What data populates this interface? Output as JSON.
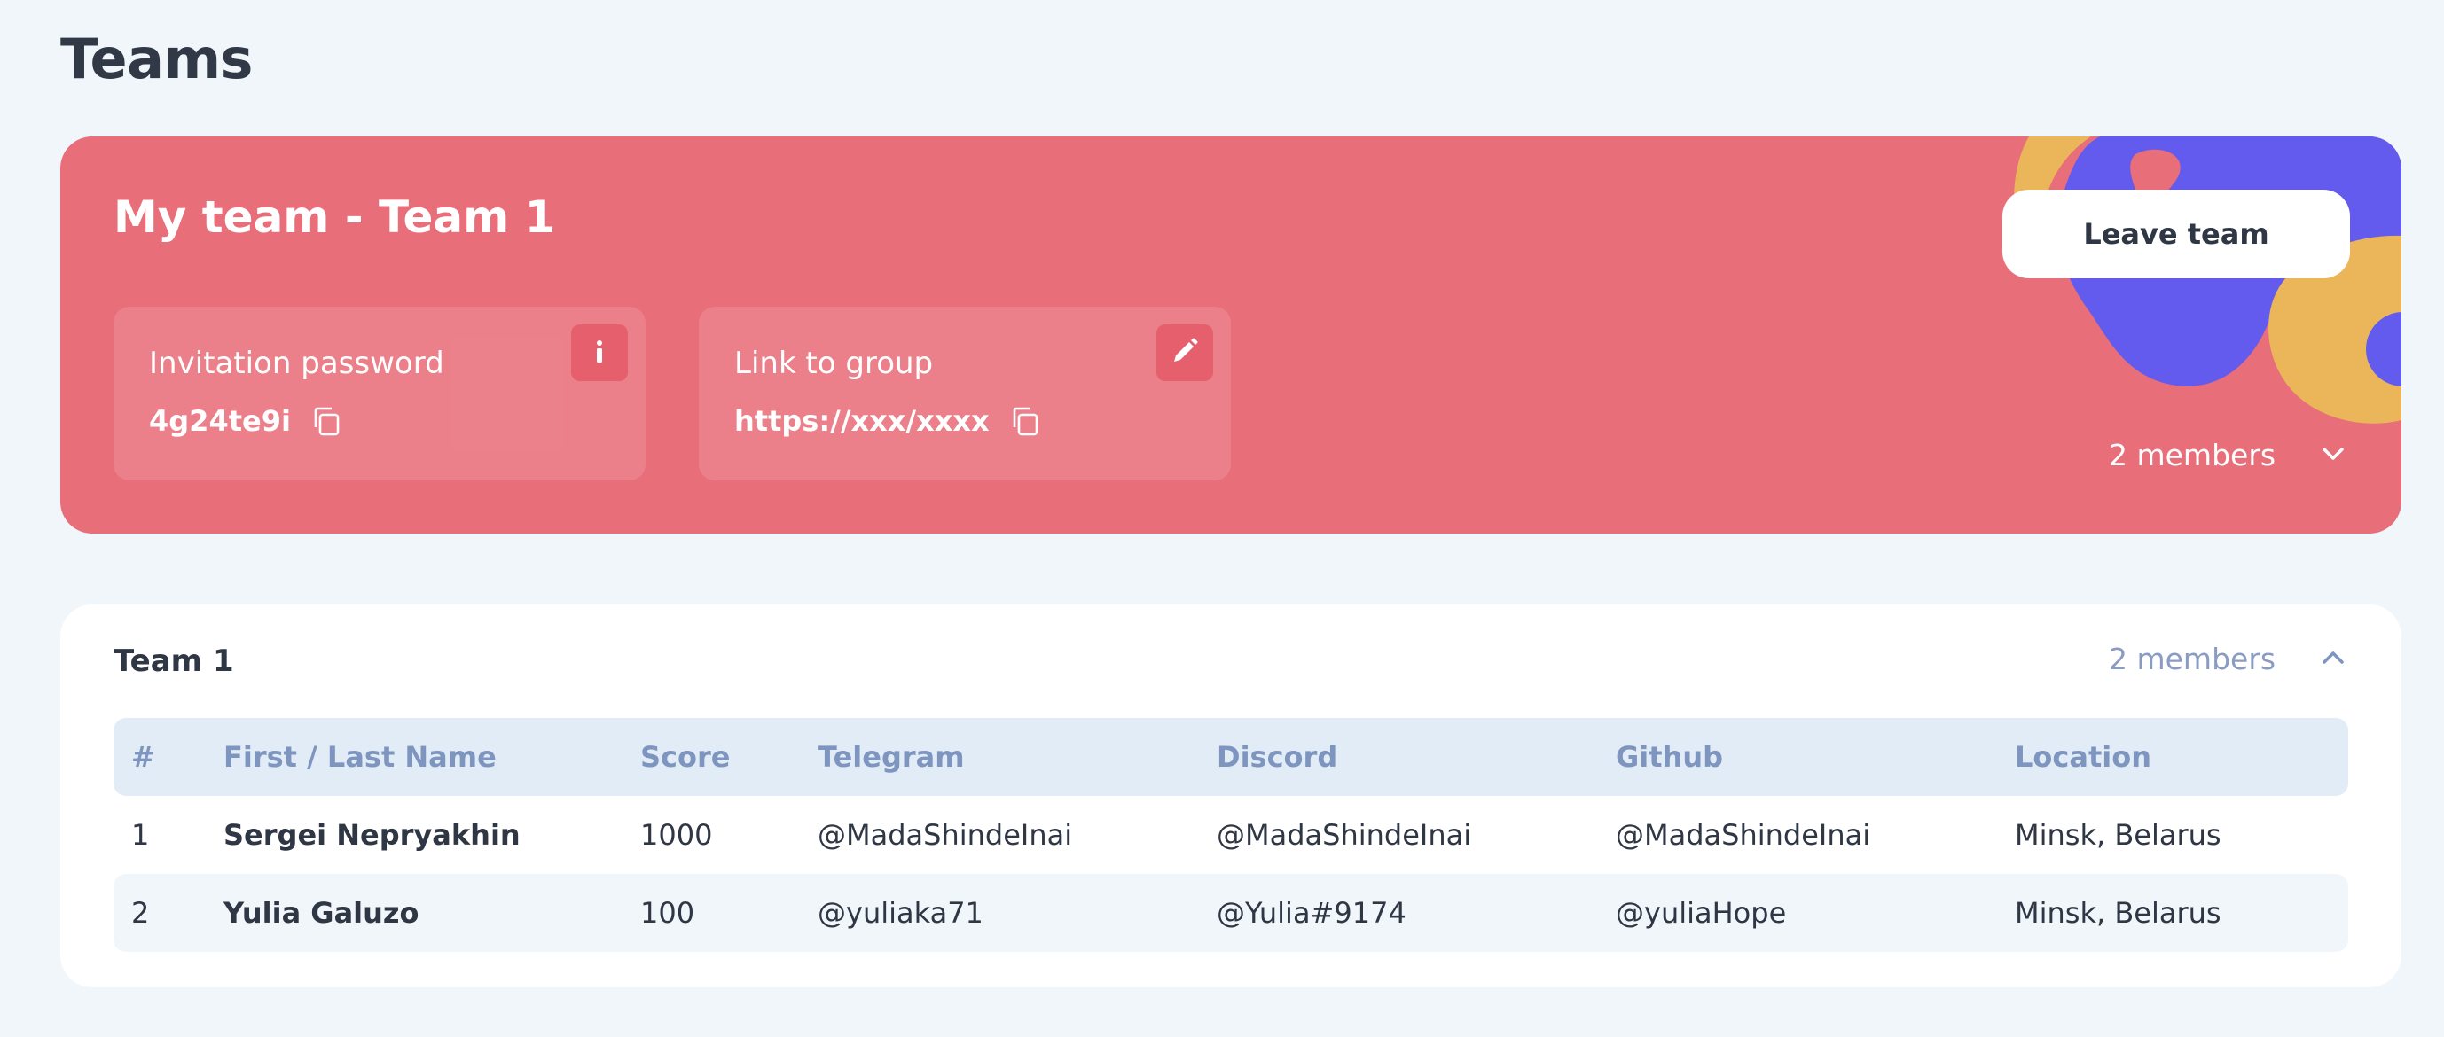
{
  "page": {
    "title": "Teams"
  },
  "my_team": {
    "title": "My team - Team 1",
    "leave_label": "Leave team",
    "members_label": "2 members",
    "invitation": {
      "label": "Invitation password",
      "value": "4g24te9i"
    },
    "group_link": {
      "label": "Link to group",
      "value": "https://xxx/xxxx"
    }
  },
  "team": {
    "name": "Team 1",
    "members_label": "2 members",
    "columns": [
      "#",
      "First / Last Name",
      "Score",
      "Telegram",
      "Discord",
      "Github",
      "Location"
    ],
    "rows": [
      [
        "1",
        "Sergei Nepryakhin",
        "1000",
        "@MadaShindeInai",
        "@MadaShindeInai",
        "@MadaShindeInai",
        "Minsk, Belarus"
      ],
      [
        "2",
        "Yulia Galuzo",
        "100",
        "@yuliaka71",
        "@Yulia#9174",
        "@yuliaHope",
        "Minsk, Belarus"
      ]
    ]
  },
  "colors": {
    "card_red": "#e86e7a",
    "blob_purple": "#635bed",
    "blob_yellow": "#ebb659",
    "page_bg": "#f1f6fb",
    "table_header_bg": "#e2ecf7",
    "header_text": "#7e95bf"
  },
  "icons": {
    "info": "info-icon",
    "edit": "pencil-icon",
    "copy": "copy-icon",
    "expand": "chevron-down-icon",
    "collapse": "chevron-up-icon"
  }
}
